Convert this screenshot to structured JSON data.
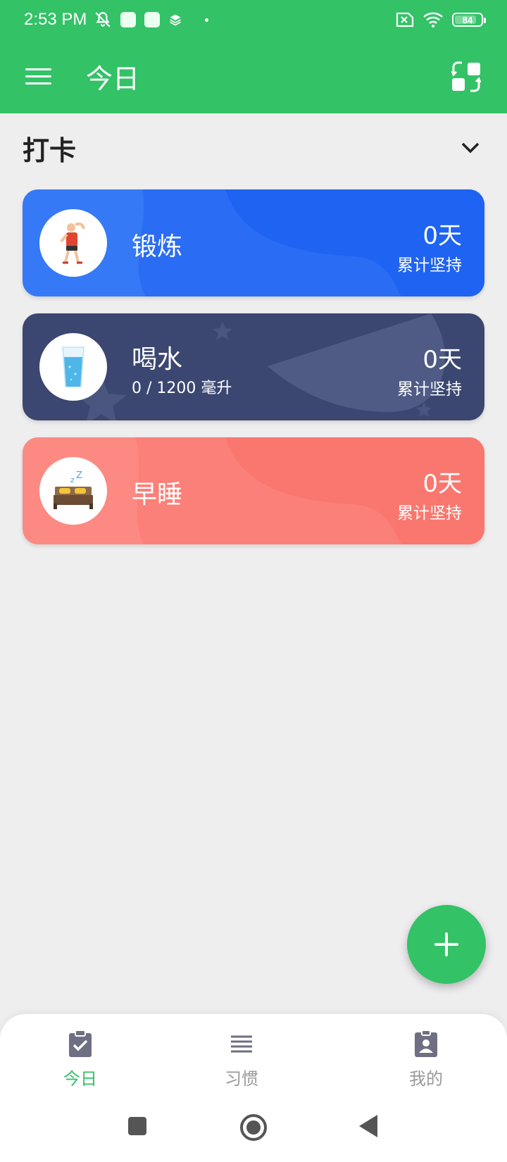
{
  "status_bar": {
    "time": "2:53 PM",
    "battery": "84",
    "battery_level": 0.84,
    "icons": [
      "mute-icon",
      "notification-icon",
      "notification-icon",
      "layers-icon",
      "dot-icon",
      "sim-off-icon",
      "wifi-icon",
      "battery-icon"
    ]
  },
  "app_bar": {
    "title": "今日",
    "menu_icon": "hamburger-menu-icon",
    "switch_icon": "switch-layout-icon"
  },
  "section": {
    "title": "打卡",
    "toggle_icon": "chevron-down-icon"
  },
  "cards": [
    {
      "name": "锻炼",
      "subtitle": "",
      "days": "0天",
      "label": "累计坚持",
      "icon": "exercise-person-icon",
      "color": "#2F72F6"
    },
    {
      "name": "喝水",
      "subtitle": "0 / 1200 毫升",
      "days": "0天",
      "label": "累计坚持",
      "icon": "water-glass-icon",
      "color": "#3B4771"
    },
    {
      "name": "早睡",
      "subtitle": "",
      "days": "0天",
      "label": "累计坚持",
      "icon": "bed-sleep-icon",
      "color": "#FC8982"
    }
  ],
  "fab": {
    "icon": "plus-icon",
    "color": "#33C266"
  },
  "bottom_nav": {
    "items": [
      {
        "label": "今日",
        "icon": "clipboard-check-icon",
        "active": true
      },
      {
        "label": "习惯",
        "icon": "list-icon",
        "active": false
      },
      {
        "label": "我的",
        "icon": "profile-badge-icon",
        "active": false
      }
    ]
  },
  "system_nav": [
    "recents-button",
    "home-button",
    "back-button"
  ],
  "colors": {
    "primary": "#33C266",
    "background": "#EEEEEF",
    "inactive": "#999999"
  }
}
